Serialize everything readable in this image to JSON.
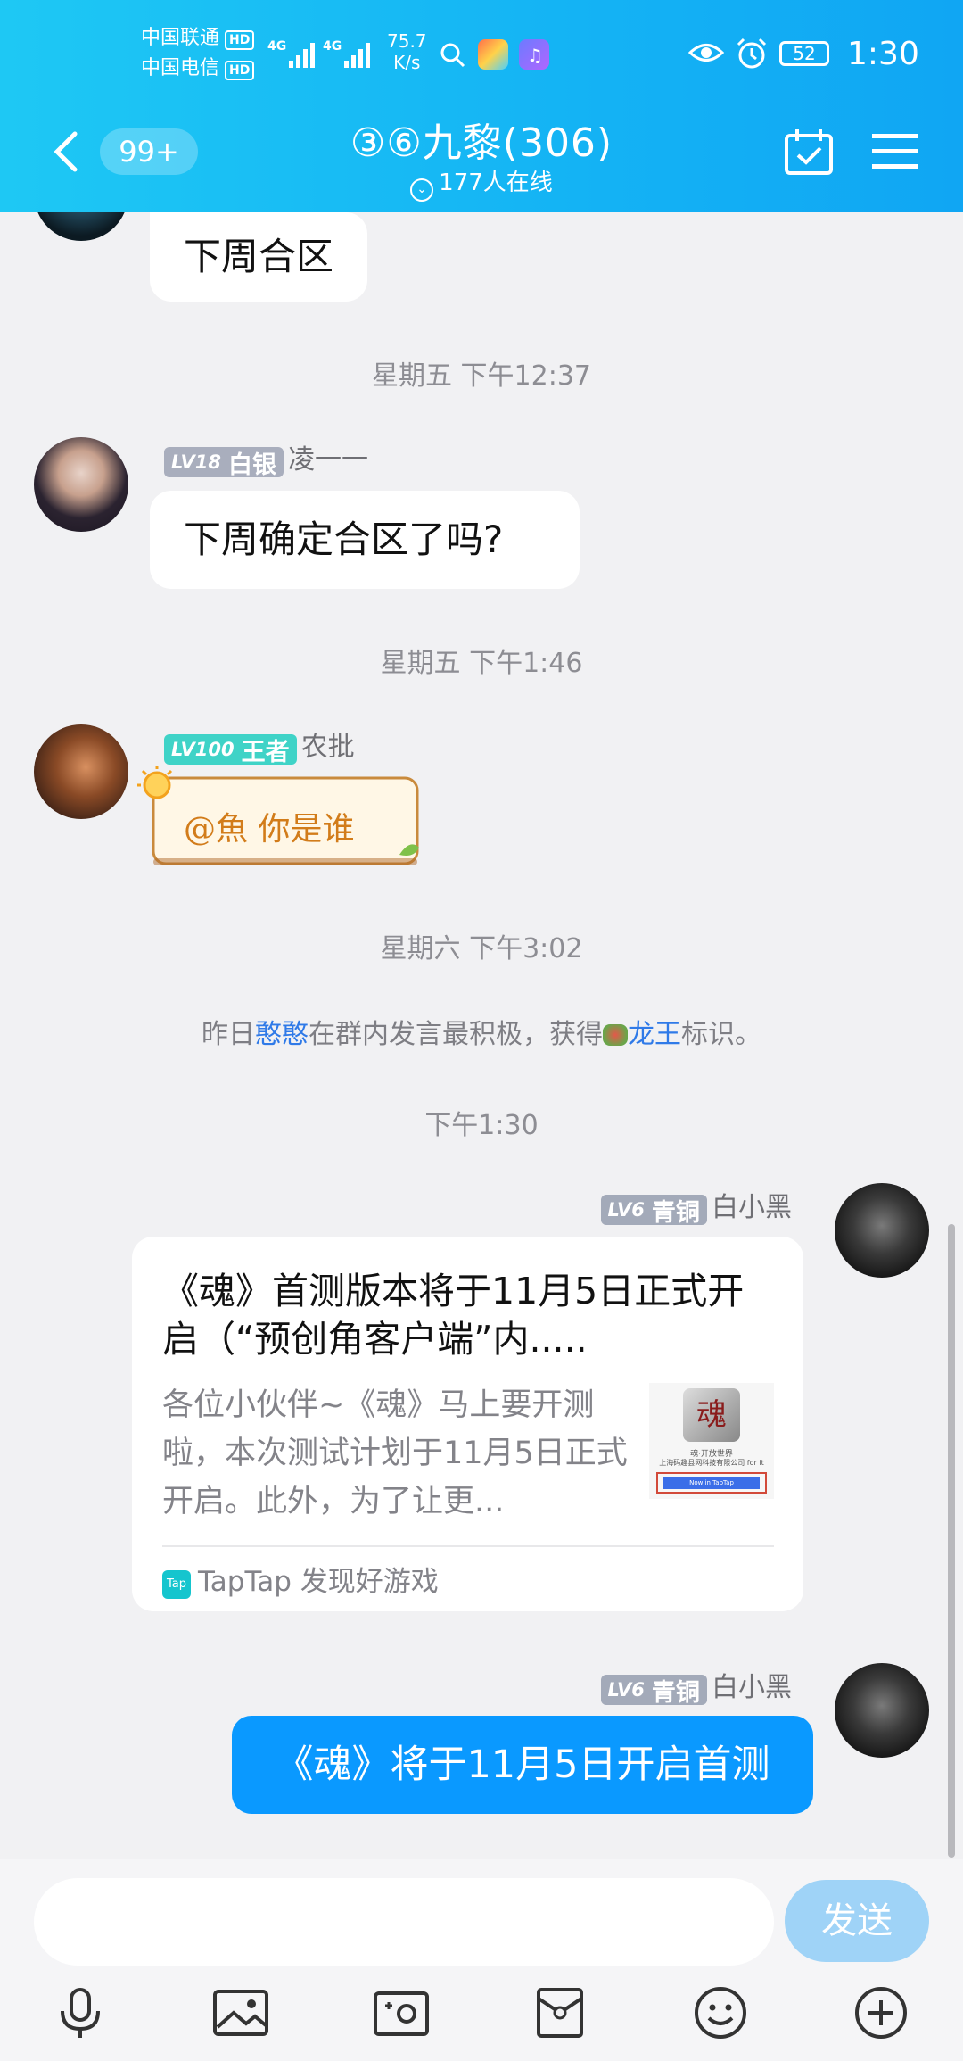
{
  "status_bar": {
    "carrier1": "中国联通",
    "carrier2": "中国电信",
    "hd": "HD",
    "net": "4G",
    "speed_value": "75.7",
    "speed_unit": "K/s",
    "battery": "52",
    "time": "1:30"
  },
  "header": {
    "unread_badge": "99+",
    "title": "③⑥九黎(306)",
    "online": "177人在线"
  },
  "messages": {
    "msg1": {
      "text": "下周合区"
    },
    "ts1": "星期五 下午12:37",
    "msg2": {
      "level": "LV18",
      "rank": "白银",
      "nick": "凌一一",
      "text": "下周确定合区了吗?"
    },
    "ts2": "星期五 下午1:46",
    "msg3": {
      "level": "LV100",
      "rank": "王者",
      "nick": "农批",
      "text": "@魚 你是谁"
    },
    "ts3": "星期六 下午3:02",
    "system": {
      "part1": "昨日",
      "name": "憨憨",
      "part2": "在群内发言最积极，获得",
      "badge": "龙王",
      "part3": "标识。"
    },
    "ts4": "下午1:30",
    "msg4": {
      "level": "LV6",
      "rank": "青铜",
      "nick": "白小黑",
      "card_title": "《魂》首测版本将于11月5日正式开启（“预创角客户端”内.....",
      "card_desc": "各位小伙伴~《魂》马上要开测啦，本次测试计划于11月5日正式开启。此外，为了让更...",
      "card_source": "TapTap 发现好游戏",
      "card_source_logo": "Tap",
      "thumb_text1": "魂",
      "thumb_text2": "魂·开放世界",
      "thumb_text3": "上海码趣县网科技有限公司 for it",
      "thumb_button": "Now in TapTap"
    },
    "msg5": {
      "level": "LV6",
      "rank": "青铜",
      "nick": "白小黑",
      "text": "《魂》将于11月5日开启首测"
    }
  },
  "composer": {
    "input_value": "",
    "send_label": "发送"
  },
  "toolbar": [
    "mic-icon",
    "image-icon",
    "camera-icon",
    "red-packet-icon",
    "emoji-icon",
    "plus-icon"
  ],
  "colors": {
    "header": "#14b3f4",
    "my_bubble": "#0a99ff",
    "lvl_silver": "#a9aebd",
    "lvl_king": "#3fd3c7",
    "lvl_bronze": "#a3aab9",
    "send": "#9fd3f7"
  }
}
